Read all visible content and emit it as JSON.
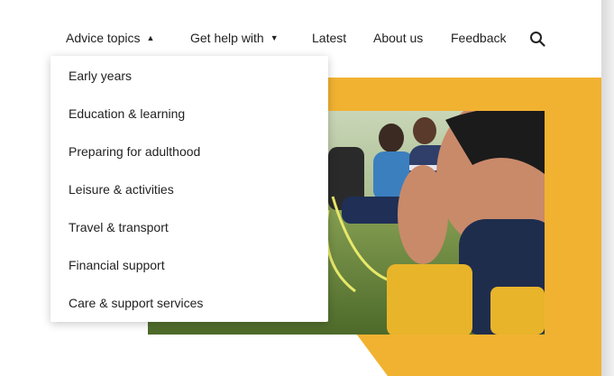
{
  "nav": {
    "items": [
      {
        "label": "Advice topics",
        "caret": "▲"
      },
      {
        "label": "Get help with",
        "caret": "▼"
      },
      {
        "label": "Latest"
      },
      {
        "label": "About us"
      },
      {
        "label": "Feedback"
      }
    ],
    "search_icon": "search-icon"
  },
  "dropdown": {
    "items": [
      {
        "label": "Early years"
      },
      {
        "label": "Education & learning"
      },
      {
        "label": "Preparing for adulthood"
      },
      {
        "label": "Leisure & activities"
      },
      {
        "label": "Travel & transport"
      },
      {
        "label": "Financial support"
      },
      {
        "label": "Care & support services"
      }
    ]
  },
  "colors": {
    "accent_yellow": "#f1b231",
    "text": "#222222",
    "background": "#ffffff"
  }
}
